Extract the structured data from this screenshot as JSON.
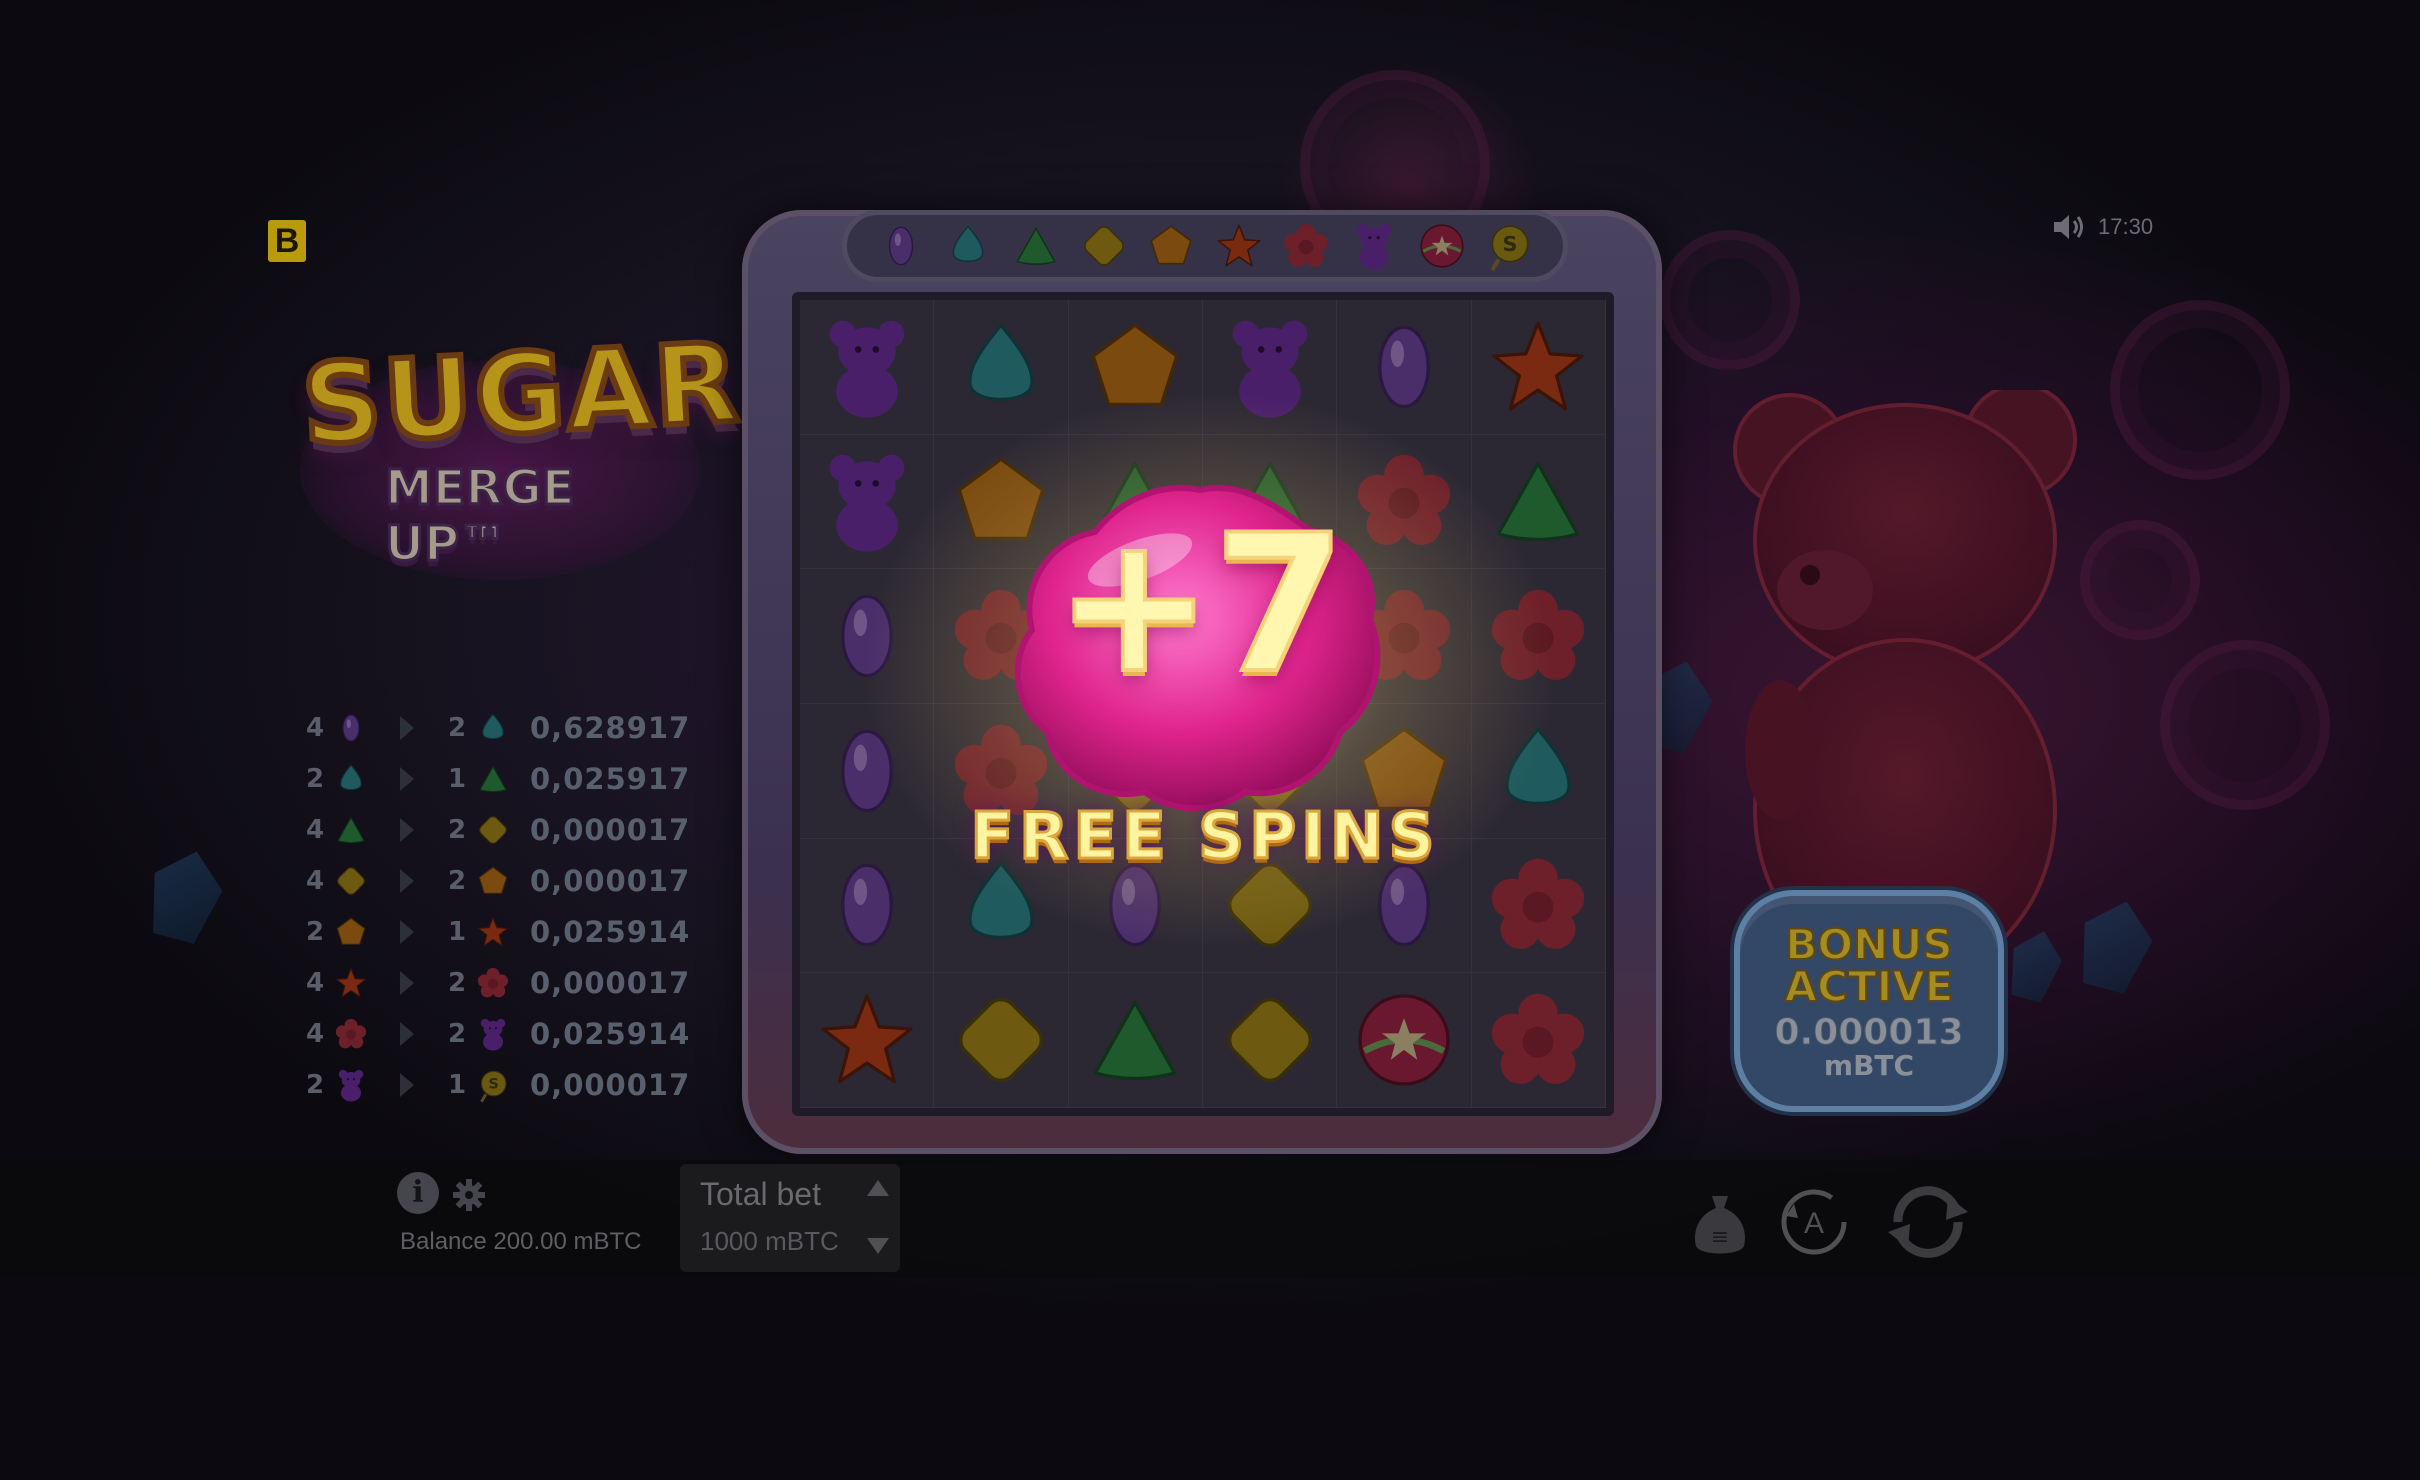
{
  "brand_badge": "B",
  "clock": {
    "time": "17:30",
    "sound_icon": "speaker-icon"
  },
  "logo": {
    "line1": "SUGAR",
    "line2": "MERGE UP™"
  },
  "paytable": [
    {
      "count_in": "4",
      "symbol_in": "purple-oval-candy",
      "count_out": "2",
      "symbol_out": "teal-drop-candy",
      "value": "0,628917"
    },
    {
      "count_in": "2",
      "symbol_in": "teal-drop-candy",
      "count_out": "1",
      "symbol_out": "green-triangle-candy",
      "value": "0,025917"
    },
    {
      "count_in": "4",
      "symbol_in": "green-triangle-candy",
      "count_out": "2",
      "symbol_out": "yellow-square-candy",
      "value": "0,000017"
    },
    {
      "count_in": "4",
      "symbol_in": "yellow-square-candy",
      "count_out": "2",
      "symbol_out": "orange-pentagon-candy",
      "value": "0,000017"
    },
    {
      "count_in": "2",
      "symbol_in": "orange-pentagon-candy",
      "count_out": "1",
      "symbol_out": "red-star-candy",
      "value": "0,025914"
    },
    {
      "count_in": "4",
      "symbol_in": "red-star-candy",
      "count_out": "2",
      "symbol_out": "red-flower-candy",
      "value": "0,000017"
    },
    {
      "count_in": "4",
      "symbol_in": "red-flower-candy",
      "count_out": "2",
      "symbol_out": "purple-bear-candy",
      "value": "0,025914"
    },
    {
      "count_in": "2",
      "symbol_in": "purple-bear-candy",
      "count_out": "1",
      "symbol_out": "s-lollipop-candy",
      "value": "0,000017"
    }
  ],
  "ladder": [
    "purple-oval-candy",
    "teal-drop-candy",
    "green-triangle-candy",
    "yellow-square-candy",
    "orange-pentagon-candy",
    "red-star-candy",
    "red-flower-candy",
    "purple-bear-candy",
    "rainbow-ball-candy",
    "s-lollipop-candy"
  ],
  "grid": [
    [
      "purple-bear-candy",
      "teal-drop-candy",
      "orange-pentagon-candy",
      "purple-bear-candy",
      "purple-oval-candy",
      "red-star-candy"
    ],
    [
      "purple-bear-candy",
      "orange-pentagon-candy",
      "green-triangle-candy",
      "green-triangle-candy",
      "red-flower-candy",
      "green-triangle-candy"
    ],
    [
      "purple-oval-candy",
      "red-flower-candy",
      "yellow-square-candy",
      "yellow-square-candy",
      "red-flower-candy",
      "red-flower-candy"
    ],
    [
      "purple-oval-candy",
      "red-flower-candy",
      "yellow-square-candy",
      "yellow-square-candy",
      "orange-pentagon-candy",
      "teal-drop-candy"
    ],
    [
      "purple-oval-candy",
      "teal-drop-candy",
      "purple-oval-candy",
      "yellow-square-candy",
      "purple-oval-candy",
      "red-flower-candy"
    ],
    [
      "red-star-candy",
      "yellow-square-candy",
      "green-triangle-candy",
      "yellow-square-candy",
      "rainbow-ball-candy",
      "red-flower-candy"
    ]
  ],
  "win_popup": {
    "amount": "+7",
    "label": "FREE SPINS"
  },
  "bonus": {
    "line1": "BONUS",
    "line2": "ACTIVE",
    "amount": "0.000013",
    "currency": "mBTC"
  },
  "bottom_bar": {
    "info_label": "i",
    "balance": "Balance 200.00 mBTC",
    "total_bet_label": "Total bet",
    "total_bet_value": "1000 mBTC"
  },
  "colors": {
    "accent": "#e0248e",
    "gold": "#fff6b0",
    "bonus_panel": "#334766"
  }
}
